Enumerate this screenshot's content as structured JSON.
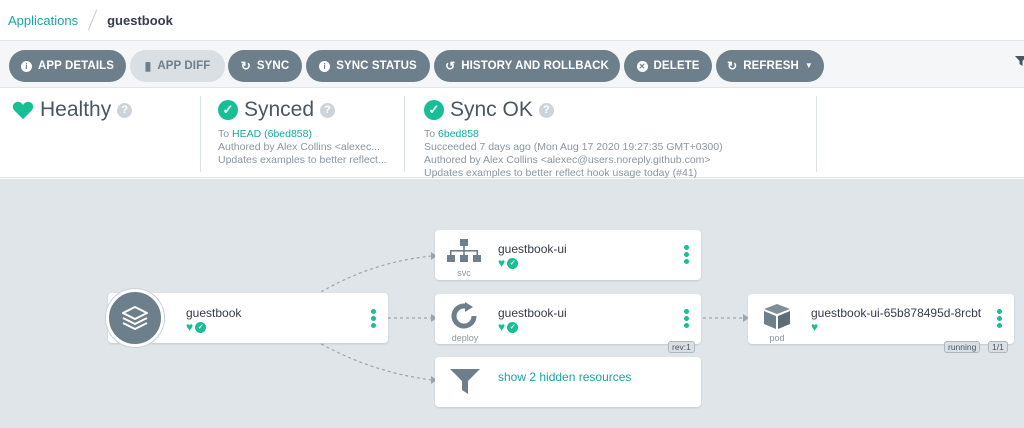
{
  "breadcrumb": {
    "root": "Applications",
    "current": "guestbook"
  },
  "toolbar": {
    "app_details": "APP DETAILS",
    "app_diff": "APP DIFF",
    "sync": "SYNC",
    "sync_status": "SYNC STATUS",
    "history": "HISTORY AND ROLLBACK",
    "delete": "DELETE",
    "refresh": "REFRESH"
  },
  "status": {
    "health": {
      "label": "Healthy"
    },
    "sync": {
      "label": "Synced",
      "to_prefix": "To ",
      "to_ref": "HEAD (6bed858)",
      "author": "Authored by Alex Collins <alexec...",
      "message": "Updates examples to better reflect..."
    },
    "operation": {
      "label": "Sync OK",
      "to_prefix": "To ",
      "to_ref": "6bed858",
      "succeeded": "Succeeded 7 days ago (Mon Aug 17 2020 19:27:35 GMT+0300)",
      "author": "Authored by Alex Collins <alexec@users.noreply.github.com>",
      "message": "Updates examples to better reflect hook usage today (#41)"
    }
  },
  "graph": {
    "app": {
      "name": "guestbook"
    },
    "svc": {
      "name": "guestbook-ui",
      "kind": "svc"
    },
    "deploy": {
      "name": "guestbook-ui",
      "kind": "deploy",
      "rev": "rev:1"
    },
    "pod": {
      "name": "guestbook-ui-65b878495d-8rcbt",
      "kind": "pod",
      "phase": "running",
      "ready": "1/1"
    },
    "hidden": {
      "label": "show 2 hidden resources"
    }
  },
  "colors": {
    "accent": "#18be94",
    "link": "#19a6a0",
    "button": "#6d7f8b",
    "graph_bg": "#dfe5e9"
  }
}
